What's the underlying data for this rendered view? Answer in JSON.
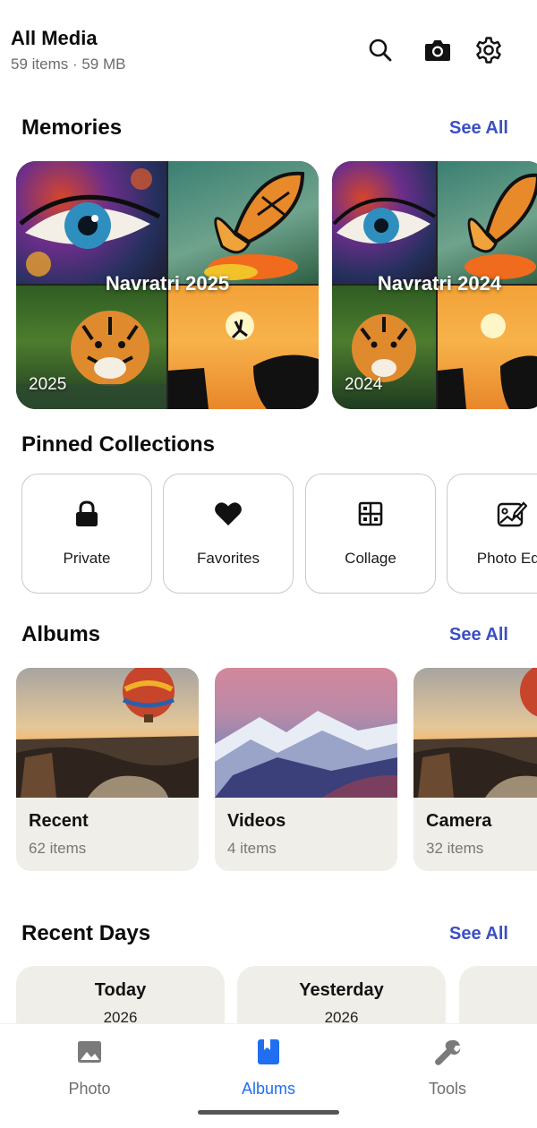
{
  "header": {
    "title": "All Media",
    "subtitle": "59 items · 59 MB",
    "icons": [
      "search-icon",
      "camera-icon",
      "settings-icon"
    ]
  },
  "memories": {
    "title": "Memories",
    "see_all": "See All",
    "items": [
      {
        "title": "Navratri 2025",
        "year": "2025"
      },
      {
        "title": "Navratri 2024",
        "year": "2024"
      }
    ]
  },
  "pinned": {
    "title": "Pinned Collections",
    "items": [
      {
        "label": "Private",
        "icon": "lock-icon"
      },
      {
        "label": "Favorites",
        "icon": "heart-icon"
      },
      {
        "label": "Collage",
        "icon": "collage-icon"
      },
      {
        "label": "Photo Edit",
        "icon": "photo-edit-icon"
      }
    ]
  },
  "albums": {
    "title": "Albums",
    "see_all": "See All",
    "items": [
      {
        "name": "Recent",
        "count": "62 items"
      },
      {
        "name": "Videos",
        "count": "4 items"
      },
      {
        "name": "Camera",
        "count": "32 items"
      }
    ]
  },
  "recent_days": {
    "title": "Recent Days",
    "see_all": "See All",
    "items": [
      {
        "title": "Today",
        "year": "2026"
      },
      {
        "title": "Yesterday",
        "year": "2026"
      },
      {
        "title": "",
        "year": ""
      }
    ]
  },
  "nav": {
    "items": [
      {
        "label": "Photo",
        "icon": "photo-icon",
        "active": false
      },
      {
        "label": "Albums",
        "icon": "albums-icon",
        "active": true
      },
      {
        "label": "Tools",
        "icon": "tools-icon",
        "active": false
      }
    ],
    "active_color": "#1f6ff0"
  },
  "colors": {
    "accent": "#3b4fc4",
    "card_bg": "#efeee8"
  }
}
